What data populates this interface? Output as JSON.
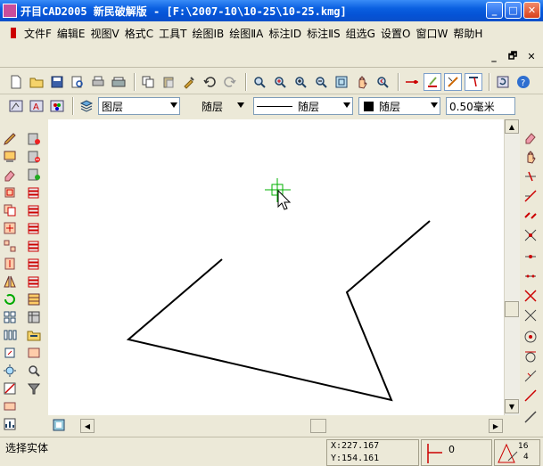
{
  "window": {
    "title": "开目CAD2005 新民破解版 - [F:\\2007-10\\10-25\\10-25.kmg]",
    "minimize": "_",
    "maximize": "□",
    "close": "✕"
  },
  "menu": {
    "items": [
      {
        "label": "文件F"
      },
      {
        "label": "编辑E"
      },
      {
        "label": "视图V"
      },
      {
        "label": "格式C"
      },
      {
        "label": "工具T"
      },
      {
        "label": "绘图ⅠB"
      },
      {
        "label": "绘图ⅡA"
      },
      {
        "label": "标注ⅠD"
      },
      {
        "label": "标注ⅡS"
      },
      {
        "label": "组选G"
      },
      {
        "label": "设置O"
      },
      {
        "label": "窗口W"
      },
      {
        "label": "帮助H"
      }
    ]
  },
  "mdi": {
    "minimize": "_",
    "restore": "🗗",
    "close": "✕"
  },
  "properties": {
    "layer": "图层",
    "linetype": "随层",
    "line_sample_label": "随层",
    "color": "随层",
    "lineweight": "0.50毫米"
  },
  "status": {
    "prompt": "选择实体",
    "coord_x": "X:227.167",
    "coord_y": "Y:154.161",
    "angle": "0",
    "snap_a": "16",
    "snap_b": "4"
  },
  "colors": {
    "title_bar": "#0553d6",
    "cursor": "#00b000",
    "drawing_line": "#000000",
    "canvas": "#ffffff"
  }
}
